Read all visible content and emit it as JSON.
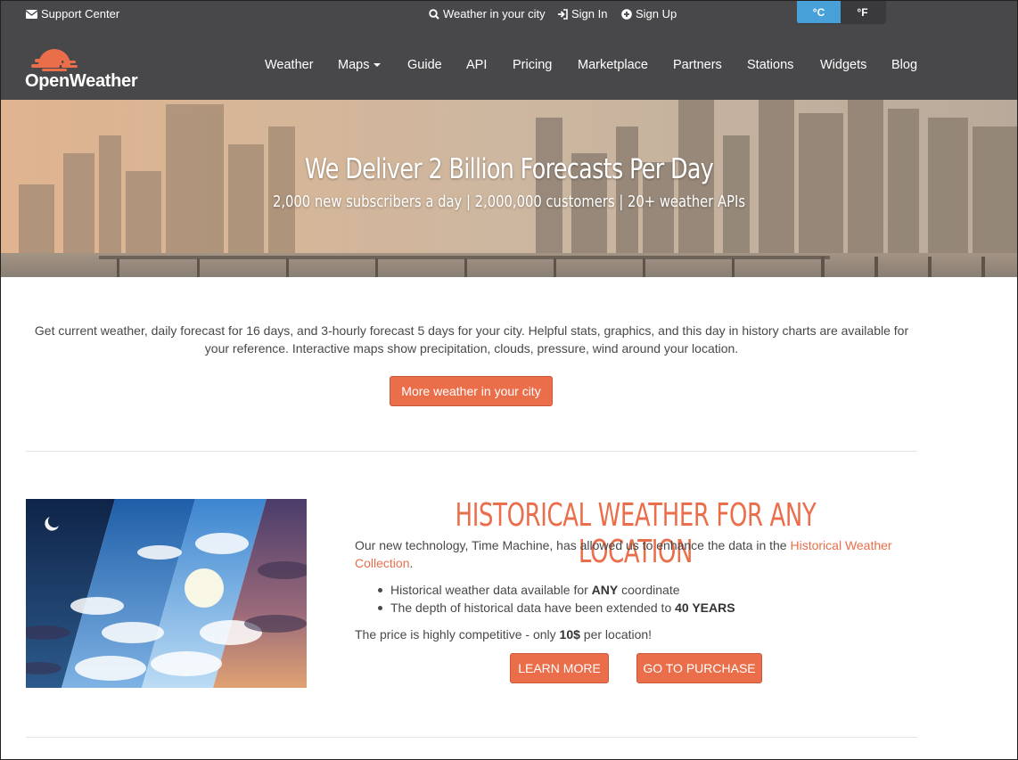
{
  "topbar": {
    "support": "Support Center",
    "search": "Weather in your city",
    "sign_in": "Sign In",
    "sign_up": "Sign Up",
    "unit_c": "°C",
    "unit_f": "°F"
  },
  "brand": {
    "name": "OpenWeather"
  },
  "nav": {
    "items": [
      "Weather",
      "Maps",
      "Guide",
      "API",
      "Pricing",
      "Marketplace",
      "Partners",
      "Stations",
      "Widgets",
      "Blog"
    ]
  },
  "hero": {
    "title": "We Deliver 2 Billion Forecasts Per Day",
    "subtitle": "2,000 new subscribers a day | 2,000,000 customers | 20+ weather APIs"
  },
  "intro": {
    "text": "Get current weather, daily forecast for 16 days, and 3-hourly forecast 5 days for your city. Helpful stats, graphics, and this day in history charts are available for your reference. Interactive maps show precipitation, clouds, pressure, wind around your location.",
    "button": "More weather in your city"
  },
  "historical": {
    "title": "HISTORICAL WEATHER FOR ANY LOCATION",
    "p1_before": "Our new technology, Time Machine, has allowed us to enhance the data in the ",
    "p1_link": "Historical Weather Collection",
    "p1_after": ".",
    "bullet1_before": "Historical weather data available for ",
    "bullet1_bold": "ANY",
    "bullet1_after": " coordinate",
    "bullet2_before": "The depth of historical data have been extended to ",
    "bullet2_bold": "40 YEARS",
    "price_before": "The price is highly competitive - only ",
    "price_bold": "10$",
    "price_after": " per location!",
    "learn_more": "LEARN MORE",
    "purchase": "GO TO PURCHASE"
  },
  "colors": {
    "accent": "#eb6e4b",
    "header": "#48484a",
    "unit_active": "#47a1d8"
  }
}
